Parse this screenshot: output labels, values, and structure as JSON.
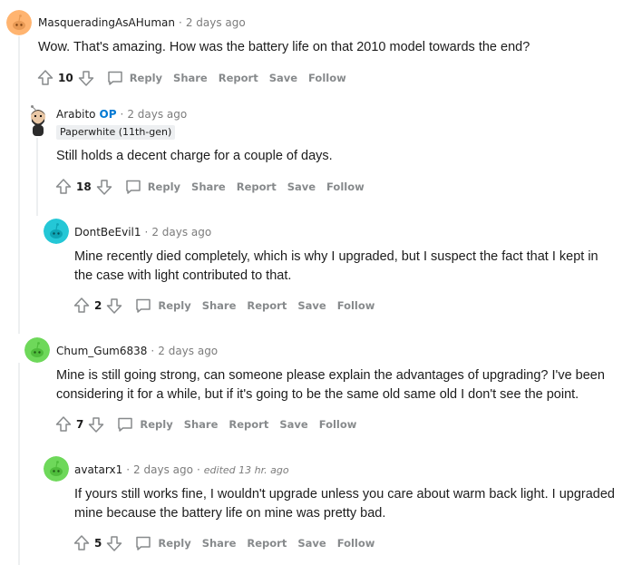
{
  "comments": [
    {
      "username": "MasqueradingAsAHuman",
      "time": "2 days ago",
      "body": [
        "Wow. That's amazing. How was the battery life on that 2010 model towards the end?"
      ],
      "score": "10"
    },
    {
      "username": "Arabito",
      "op_label": "OP",
      "time": "2 days ago",
      "flair": "Paperwhite (11th-gen)",
      "body": [
        "Still holds a decent charge for a couple of days."
      ],
      "score": "18"
    },
    {
      "username": "DontBeEvil1",
      "time": "2 days ago",
      "body": [
        "Mine recently died completely, which is why I upgraded, but I suspect the fact that I kept in",
        "the case with light contributed to that."
      ],
      "score": "2"
    },
    {
      "username": "Chum_Gum6838",
      "time": "2 days ago",
      "body": [
        "Mine is still going strong, can someone please explain the advantages of upgrading? I've been",
        "considering it for a while, but if it's going to be the same old same old I don't see the point."
      ],
      "score": "7"
    },
    {
      "username": "avatarx1",
      "time": "2 days ago",
      "edited": "edited 13 hr. ago",
      "body": [
        "If yours still works fine, I wouldn't upgrade unless you care about warm back light. I upgraded",
        "mine because the battery life on mine was pretty bad."
      ],
      "score": "5"
    }
  ],
  "actions": {
    "reply": "Reply",
    "share": "Share",
    "report": "Report",
    "save": "Save",
    "follow": "Follow"
  },
  "colors": {
    "op": "#0079d3",
    "meta": "#7c7c7c",
    "action": "#878a8c",
    "thread_line": "#edeff1",
    "avatar_orange": "#ffb470",
    "avatar_teal": "#24c7d6",
    "avatar_green": "#6ed85a"
  },
  "icons": [
    "snoo-avatar-icon",
    "upvote-arrow-icon",
    "downvote-arrow-icon",
    "reply-bubble-icon"
  ]
}
